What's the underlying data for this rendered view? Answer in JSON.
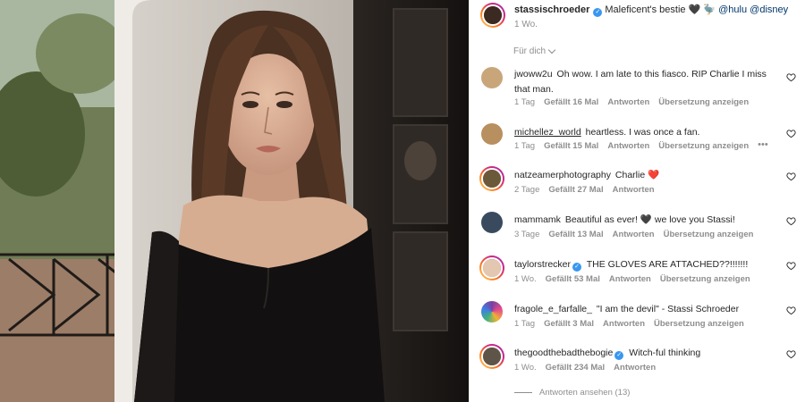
{
  "post": {
    "username": "stassischroeder",
    "caption_text": "Maleficent's bestie",
    "caption_emoji": "🖤 🦤",
    "mention_1": "@hulu",
    "mention_2": "@disney",
    "time": "1 Wo."
  },
  "filter_label": "Für dich",
  "comments": [
    {
      "username": "jwoww2u",
      "text": "Oh wow. I am late to this fiasco. RIP Charlie I miss that man.",
      "time": "1 Tag",
      "likes": "Gefällt 16 Mal",
      "reply": "Antworten",
      "translate": "Übersetzung anzeigen",
      "avatar_color": "#c9a67a"
    },
    {
      "username": "michellez_world",
      "text": "heartless. I was once a fan.",
      "time": "1 Tag",
      "likes": "Gefällt 15 Mal",
      "reply": "Antworten",
      "translate": "Übersetzung anzeigen",
      "more": "•••",
      "avatar_color": "#b88f5e"
    },
    {
      "username": "natzeamerphotography",
      "text": "Charlie",
      "emoji": "❤️",
      "time": "2 Tage",
      "likes": "Gefällt 27 Mal",
      "reply": "Antworten",
      "avatar_color": "#6b5a3a"
    },
    {
      "username": "mammamk",
      "text": "Beautiful as ever! 🖤 we love you Stassi!",
      "time": "3 Tage",
      "likes": "Gefällt 13 Mal",
      "reply": "Antworten",
      "translate": "Übersetzung anzeigen",
      "avatar_color": "#3a4a5e"
    },
    {
      "username": "taylorstrecker",
      "text": "THE GLOVES ARE ATTACHED??!!!!!!!",
      "time": "1 Wo.",
      "likes": "Gefällt 53 Mal",
      "reply": "Antworten",
      "translate": "Übersetzung anzeigen",
      "avatar_color": "#e3c7b0"
    },
    {
      "username": "fragole_e_farfalle_",
      "text": "\"I am the devil\" - Stassi Schroeder",
      "time": "1 Tag",
      "likes": "Gefällt 3 Mal",
      "reply": "Antworten",
      "translate": "Übersetzung anzeigen",
      "avatar_color": "#7a3fa0"
    },
    {
      "username": "thegoodthebadthebogie",
      "text": "Witch-ful thinking",
      "time": "1 Wo.",
      "likes": "Gefällt 234 Mal",
      "reply": "Antworten",
      "avatar_color": "#5e5548"
    }
  ],
  "view_replies": "Antworten ansehen (13)",
  "colors": {
    "accent": "#3897f0",
    "secondary_text": "#8e8e8e",
    "link": "#00376b",
    "heart_red": "#ed4956"
  }
}
